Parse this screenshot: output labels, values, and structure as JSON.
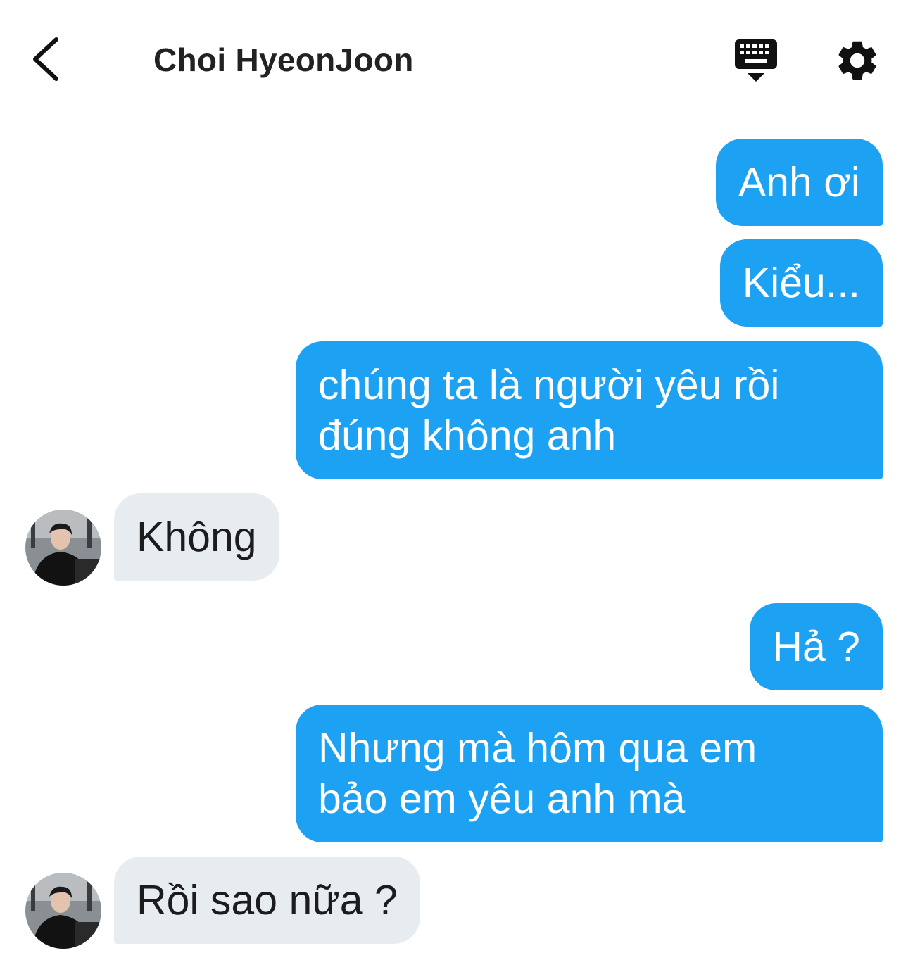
{
  "header": {
    "contact_name": "Choi HyeonJoon",
    "icons": [
      "back-icon",
      "keyboard-icon",
      "gear-icon"
    ]
  },
  "colors": {
    "sent_bubble": "#1da1f2",
    "received_bubble": "#e6ecf0",
    "background": "#ffffff"
  },
  "messages": [
    {
      "from": "me",
      "text": "Anh ơi"
    },
    {
      "from": "me",
      "text": "Kiểu..."
    },
    {
      "from": "me",
      "lines": [
        "chúng ta là người yêu rồi",
        "đúng không anh"
      ]
    },
    {
      "from": "contact",
      "text": "Không"
    },
    {
      "from": "me",
      "text": "Hả ?"
    },
    {
      "from": "me",
      "lines": [
        "Nhưng mà hôm qua em",
        "bảo em yêu anh mà"
      ]
    },
    {
      "from": "contact",
      "text": "Rồi sao nữa ?"
    }
  ]
}
